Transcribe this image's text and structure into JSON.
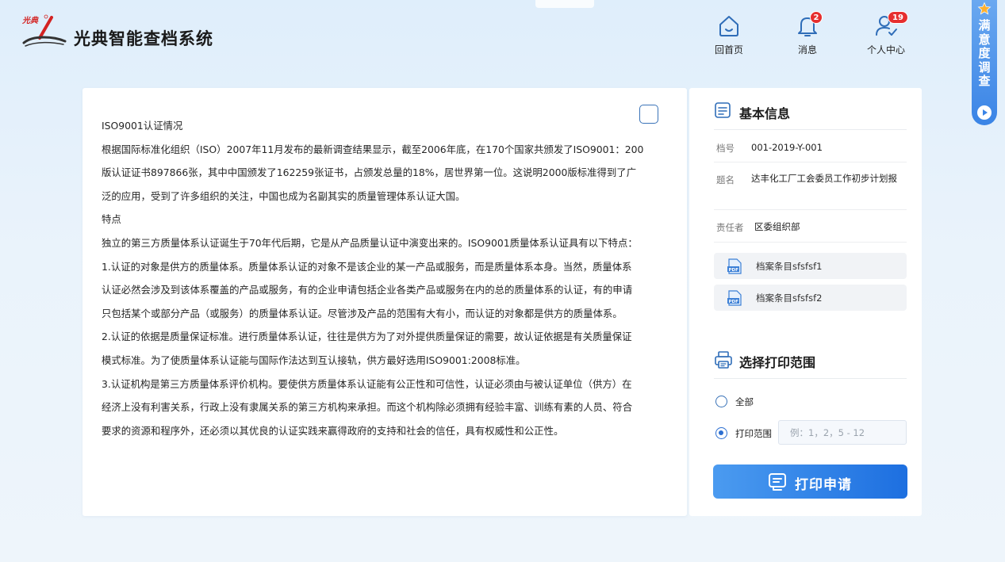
{
  "header": {
    "logo_text": "光典",
    "title": "光典智能查档系统",
    "nav": [
      {
        "label": "回首页",
        "icon": "home-icon"
      },
      {
        "label": "消息",
        "icon": "bell-icon",
        "badge": "2"
      },
      {
        "label": "个人中心",
        "icon": "user-check-icon",
        "badge": "19"
      }
    ]
  },
  "survey": {
    "label": "满意度调查",
    "chars": [
      "满",
      "意",
      "度",
      "调",
      "查"
    ]
  },
  "document": {
    "lines": [
      "ISO9001认证情况",
      "根据国际标准化组织（ISO）2007年11月发布的最新调查结果显示，截至2006年底，在170个国家共颁发了ISO9001：200",
      "版认证证书897866张，其中中国颁发了162259张证书，占颁发总量的18%，居世界第一位。这说明2000版标准得到了广",
      "泛的应用，受到了许多组织的关注，中国也成为名副其实的质量管理体系认证大国。",
      "特点",
      "独立的第三方质量体系认证诞生于70年代后期，它是从产品质量认证中演变出来的。ISO9001质量体系认证具有以下特点：",
      "1.认证的对象是供方的质量体系。质量体系认证的对象不是该企业的某一产品或服务，而是质量体系本身。当然，质量体系",
      "认证必然会涉及到该体系覆盖的产品或服务，有的企业申请包括企业各类产品或服务在内的总的质量体系的认证，有的申请",
      "只包括某个或部分产品（或服务）的质量体系认证。尽管涉及产品的范围有大有小，而认证的对象都是供方的质量体系。",
      "2.认证的依据是质量保证标准。进行质量体系认证，往往是供方为了对外提供质量保证的需要，故认证依据是有关质量保证",
      "模式标准。为了使质量体系认证能与国际作法达到互认接轨，供方最好选用ISO9001:2008标准。",
      "3.认证机构是第三方质量体系评价机构。要使供方质量体系认证能有公正性和可信性，认证必须由与被认证单位（供方）在",
      "经济上没有利害关系，行政上没有隶属关系的第三方机构来承担。而这个机构除必须拥有经验丰富、训练有素的人员、符合",
      "要求的资源和程序外，还必须以其优良的认证实践来赢得政府的支持和社会的信任，具有权威性和公正性。"
    ]
  },
  "basic_info": {
    "heading": "基本信息",
    "fields": [
      {
        "key": "档号",
        "value": "001-2019-Y-001"
      },
      {
        "key": "题名",
        "value": "达丰化工厂工会委员工作初步计划报"
      },
      {
        "key": "责任者",
        "value": "区委组织部"
      }
    ],
    "files": [
      {
        "name": "档案条目sfsfsf1",
        "icon": "pdf-icon"
      },
      {
        "name": "档案条目sfsfsf2",
        "icon": "pdf-icon"
      }
    ]
  },
  "print": {
    "heading": "选择打印范围",
    "option_all": "全部",
    "option_range": "打印范围",
    "selected": "range",
    "range_placeholder": "例：1，2，5 - 12",
    "range_value": "",
    "button_label": "打印申请"
  },
  "colors": {
    "accent": "#1d6fe0",
    "badge": "#e62e2e",
    "logo_red": "#d32222"
  }
}
